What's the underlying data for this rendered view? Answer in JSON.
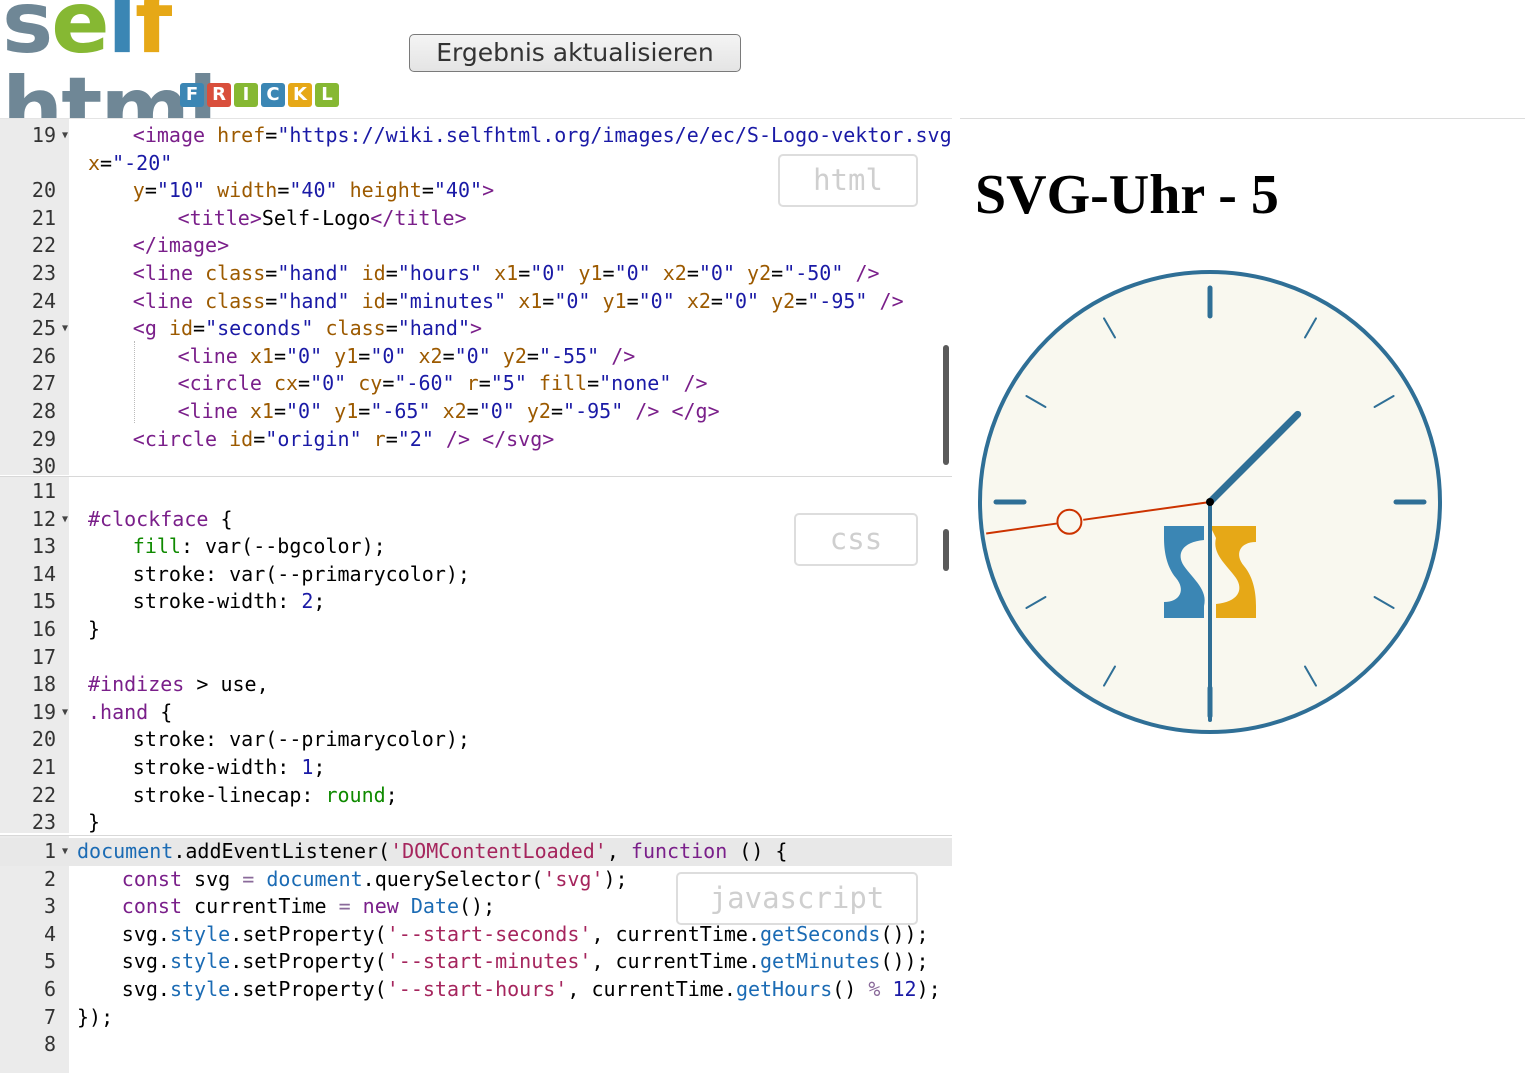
{
  "header": {
    "logo_text": "selfhtml",
    "logo_sub": [
      "F",
      "R",
      "I",
      "C",
      "K",
      "L"
    ],
    "update_button": "Ergebnis aktualisieren"
  },
  "editors": {
    "html": {
      "label": "html",
      "lines": [
        {
          "n": "19",
          "fold": true,
          "code": "<image href=\"https://wiki.selfhtml.org/images/e/ec/S-Logo-vektor.svg\""
        },
        {
          "n": "",
          "code": "x=\"-20\""
        },
        {
          "n": "20",
          "code": "y=\"10\" width=\"40\" height=\"40\">"
        },
        {
          "n": "21",
          "code": "<title>Self-Logo</title>"
        },
        {
          "n": "22",
          "code": "</image>"
        },
        {
          "n": "23",
          "code": "<line class=\"hand\" id=\"hours\" x1=\"0\" y1=\"0\" x2=\"0\" y2=\"-50\" />"
        },
        {
          "n": "24",
          "code": "<line class=\"hand\" id=\"minutes\" x1=\"0\" y1=\"0\" x2=\"0\" y2=\"-95\" />"
        },
        {
          "n": "25",
          "fold": true,
          "code": "<g id=\"seconds\" class=\"hand\">"
        },
        {
          "n": "26",
          "code": "<line x1=\"0\" y1=\"0\" x2=\"0\" y2=\"-55\" />"
        },
        {
          "n": "27",
          "code": "<circle cx=\"0\" cy=\"-60\" r=\"5\" fill=\"none\" />"
        },
        {
          "n": "28",
          "code": "<line x1=\"0\" y1=\"-65\" x2=\"0\" y2=\"-95\" /> </g>"
        },
        {
          "n": "29",
          "code": "<circle id=\"origin\" r=\"2\" /> </svg>"
        },
        {
          "n": "30",
          "code": ""
        }
      ]
    },
    "css": {
      "label": "css",
      "lines": [
        {
          "n": "11",
          "code": ""
        },
        {
          "n": "12",
          "fold": true,
          "code": "#clockface {"
        },
        {
          "n": "13",
          "code": "fill: var(--bgcolor);"
        },
        {
          "n": "14",
          "code": "stroke: var(--primarycolor);"
        },
        {
          "n": "15",
          "code": "stroke-width: 2;"
        },
        {
          "n": "16",
          "code": "}"
        },
        {
          "n": "17",
          "code": ""
        },
        {
          "n": "18",
          "code": "#indizes > use,"
        },
        {
          "n": "19",
          "fold": true,
          "code": ".hand {"
        },
        {
          "n": "20",
          "code": "stroke: var(--primarycolor);"
        },
        {
          "n": "21",
          "code": "stroke-width: 1;"
        },
        {
          "n": "22",
          "code": "stroke-linecap: round;"
        },
        {
          "n": "23",
          "code": "}"
        }
      ]
    },
    "js": {
      "label": "javascript",
      "lines": [
        {
          "n": "1",
          "fold": true,
          "code": "document.addEventListener('DOMContentLoaded', function () {"
        },
        {
          "n": "2",
          "code": "const svg = document.querySelector('svg');"
        },
        {
          "n": "3",
          "code": "const currentTime = new Date();"
        },
        {
          "n": "4",
          "code": "svg.style.setProperty('--start-seconds', currentTime.getSeconds());"
        },
        {
          "n": "5",
          "code": "svg.style.setProperty('--start-minutes', currentTime.getMinutes());"
        },
        {
          "n": "6",
          "code": "svg.style.setProperty('--start-hours', currentTime.getHours() % 12);"
        },
        {
          "n": "7",
          "code": "});"
        },
        {
          "n": "8",
          "code": ""
        }
      ]
    }
  },
  "preview": {
    "heading": "SVG-Uhr - 5",
    "clock": {
      "face_color": "#f9f8ef",
      "primary_color": "#2f6f96",
      "second_color": "#cc3300",
      "logo_blue": "#3b86b4",
      "logo_gold": "#e6a817",
      "hour_angle_deg": 45,
      "minute_angle_deg": 180,
      "second_angle_deg": 262
    }
  },
  "colors": {
    "logo_s": "#6f8796",
    "logo_e": "#86b833",
    "logo_l": "#3b86b4",
    "logo_f": "#e6a817",
    "frickl": [
      "#3b86b4",
      "#d94f3c",
      "#86b833",
      "#3b86b4",
      "#e6a817",
      "#86b833"
    ]
  }
}
